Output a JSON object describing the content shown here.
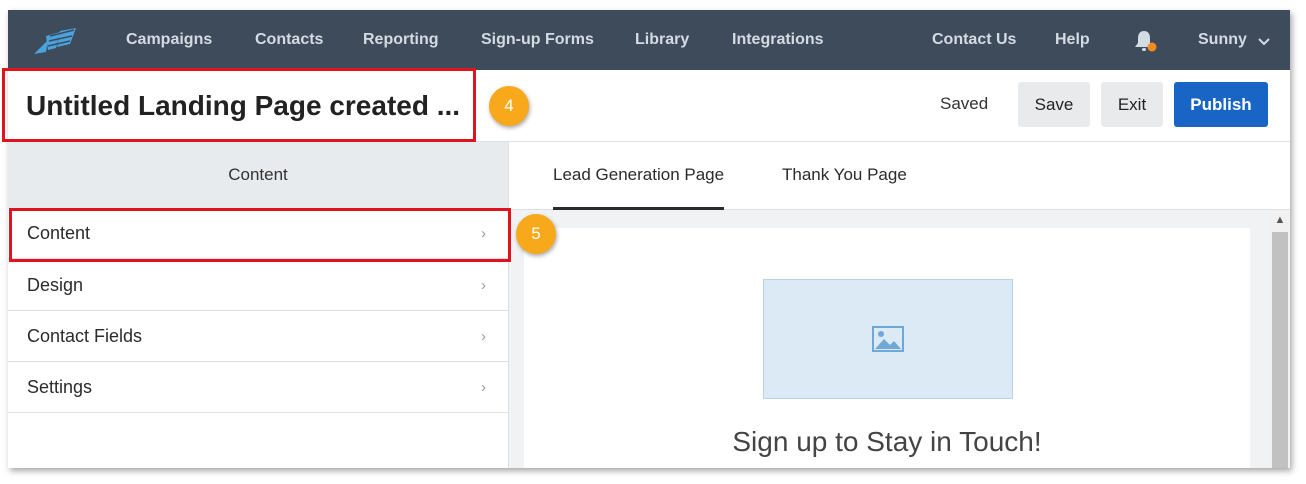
{
  "nav": {
    "items": [
      "Campaigns",
      "Contacts",
      "Reporting",
      "Sign-up Forms",
      "Library",
      "Integrations"
    ],
    "right_items": [
      "Contact Us",
      "Help"
    ],
    "user": "Sunny"
  },
  "header": {
    "title": "Untitled Landing Page created ...",
    "status": "Saved",
    "save_label": "Save",
    "exit_label": "Exit",
    "publish_label": "Publish"
  },
  "callouts": [
    "4",
    "5"
  ],
  "left_panel": {
    "heading": "Content",
    "items": [
      {
        "label": "Content"
      },
      {
        "label": "Design"
      },
      {
        "label": "Contact Fields"
      },
      {
        "label": "Settings"
      }
    ],
    "arrow_glyph": "›"
  },
  "tabs": [
    {
      "label": "Lead Generation Page",
      "active": true
    },
    {
      "label": "Thank You Page",
      "active": false
    }
  ],
  "preview": {
    "headline": "Sign up to Stay in Touch!"
  },
  "colors": {
    "nav_bg": "#3d4b5a",
    "publish_blue": "#1865c6",
    "highlight_red": "#e0141e",
    "callout_orange": "#f7a81b"
  }
}
